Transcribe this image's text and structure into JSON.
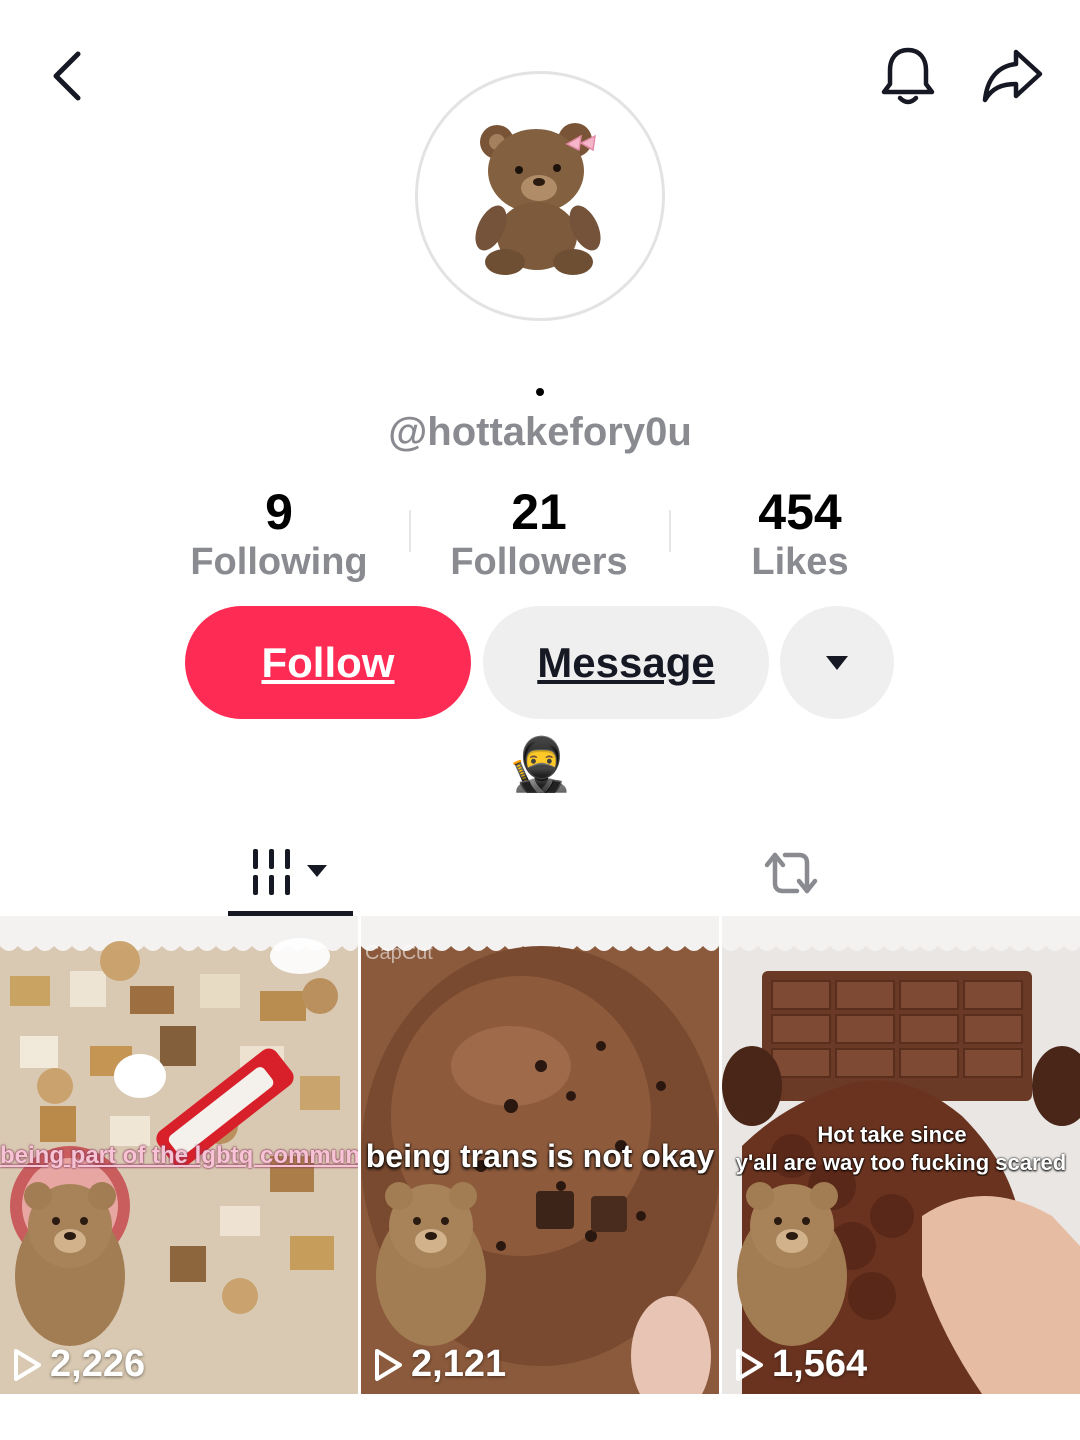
{
  "header": {
    "back_icon": "chevron-left-icon",
    "bell_icon": "bell-icon",
    "share_icon": "share-arrow-icon"
  },
  "profile": {
    "display_name": "•",
    "username": "@hottakefory0u",
    "bio": "🥷"
  },
  "stats": [
    {
      "value": "9",
      "label": "Following"
    },
    {
      "value": "21",
      "label": "Followers"
    },
    {
      "value": "454",
      "label": "Likes"
    }
  ],
  "actions": {
    "follow_label": "Follow",
    "message_label": "Message",
    "more_icon": "caret-down-icon"
  },
  "tabs": [
    {
      "icon": "videos-grid-icon",
      "active": true
    },
    {
      "icon": "repost-icon",
      "active": false
    }
  ],
  "videos": [
    {
      "caption": "being part of the lgbtq community",
      "views": "2,226"
    },
    {
      "caption": "being trans is not okay",
      "watermark": "CapCut",
      "views": "2,121"
    },
    {
      "caption_line1": "Hot take since",
      "caption_line2": "y'all are way too fucking scared",
      "views": "1,564"
    }
  ],
  "colors": {
    "accent": "#fe2c55",
    "muted_text": "#8a8b91",
    "button_gray": "#efefef"
  }
}
